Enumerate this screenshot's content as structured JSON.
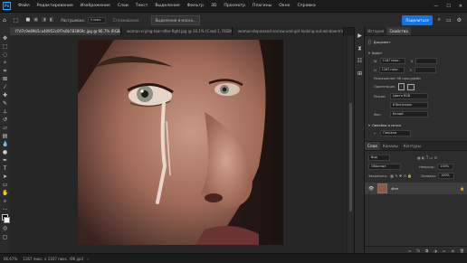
{
  "menu": {
    "app_icon": "ps-logo-icon",
    "items": [
      "Файл",
      "Редактирование",
      "Изображение",
      "Слои",
      "Текст",
      "Выделение",
      "Фильтр",
      "3D",
      "Просмотр",
      "Плагины",
      "Окно",
      "Справка"
    ]
  },
  "options": {
    "field1": "Растушевка:",
    "field2": "0 пикс",
    "smooth": "Сглаживание",
    "refine_button": "Выделение и маска...",
    "share_button": "Поделиться"
  },
  "tabs": [
    "f7d7c9e89b5ca40952c0f7e0b783869c.jpg @ 66,7% (RGB/8#)",
    "woman-crying-tear-after-fight.jpg @ 16,1% (Слой 1, RGB/8)",
    "woman-depressed-sorrow-and-girl-looking-out-window-tristeza.jpg"
  ],
  "panel": {
    "top_tabs": [
      "История",
      "Свойства"
    ],
    "doc_title": "Документ",
    "canvas_label": "Холст",
    "width_value": "1167 пикс.",
    "height_value": "1167 пикс.",
    "x_label": "X",
    "y_label": "Y",
    "orientation_label": "Ориентация",
    "resolution_label": "Разрешение: 96 пикс/дюйм",
    "mode_label": "Режим",
    "mode_value": "Цвета RGB",
    "depth_value": "8 бит/канал",
    "fill_label": "Фон",
    "fill_value": "Белый",
    "rulers_label": "Линейки и сетки",
    "rulers_value": "Пиксели",
    "layer_tabs": [
      "Слои",
      "Каналы",
      "Контуры"
    ],
    "search_placeholder": "Вид",
    "blend_mode": "Обычные",
    "opacity_label": "Непрозр.:",
    "opacity_value": "100%",
    "lock_label": "Закрепить:",
    "fill_pct_label": "Заливка:",
    "fill_pct_value": "100%",
    "layer_name": "Фон"
  },
  "status": {
    "zoom": "66,67%",
    "size": "1167 пикс. x 1167 пикс. (96 ppi)"
  }
}
